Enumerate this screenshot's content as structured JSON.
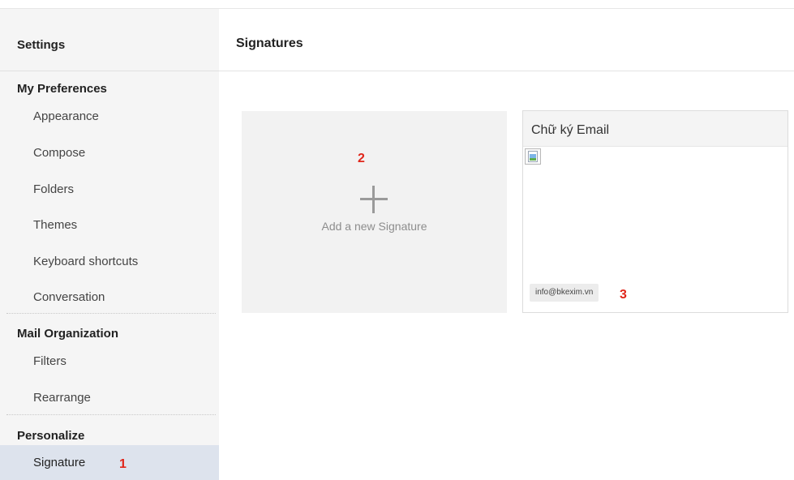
{
  "sidebar": {
    "title": "Settings",
    "sections": [
      {
        "heading": "My Preferences",
        "items": [
          "Appearance",
          "Compose",
          "Folders",
          "Themes",
          "Keyboard shortcuts",
          "Conversation"
        ]
      },
      {
        "heading": "Mail Organization",
        "items": [
          "Filters",
          "Rearrange"
        ]
      },
      {
        "heading": "Personalize",
        "items": [
          "Signature"
        ]
      }
    ],
    "active_item": "Signature"
  },
  "main": {
    "title": "Signatures",
    "add_card": {
      "label": "Add a new Signature"
    },
    "signature_card": {
      "title": "Chữ ký Email",
      "email": "info@bkexim.vn"
    }
  },
  "annotations": [
    "1",
    "2",
    "3"
  ],
  "colors": {
    "annotation": "#e0261b",
    "active_bg": "#dde3ed",
    "sidebar_bg": "#f5f5f5"
  },
  "icons": {
    "add": "plus-icon",
    "broken_image": "broken-image-icon"
  }
}
